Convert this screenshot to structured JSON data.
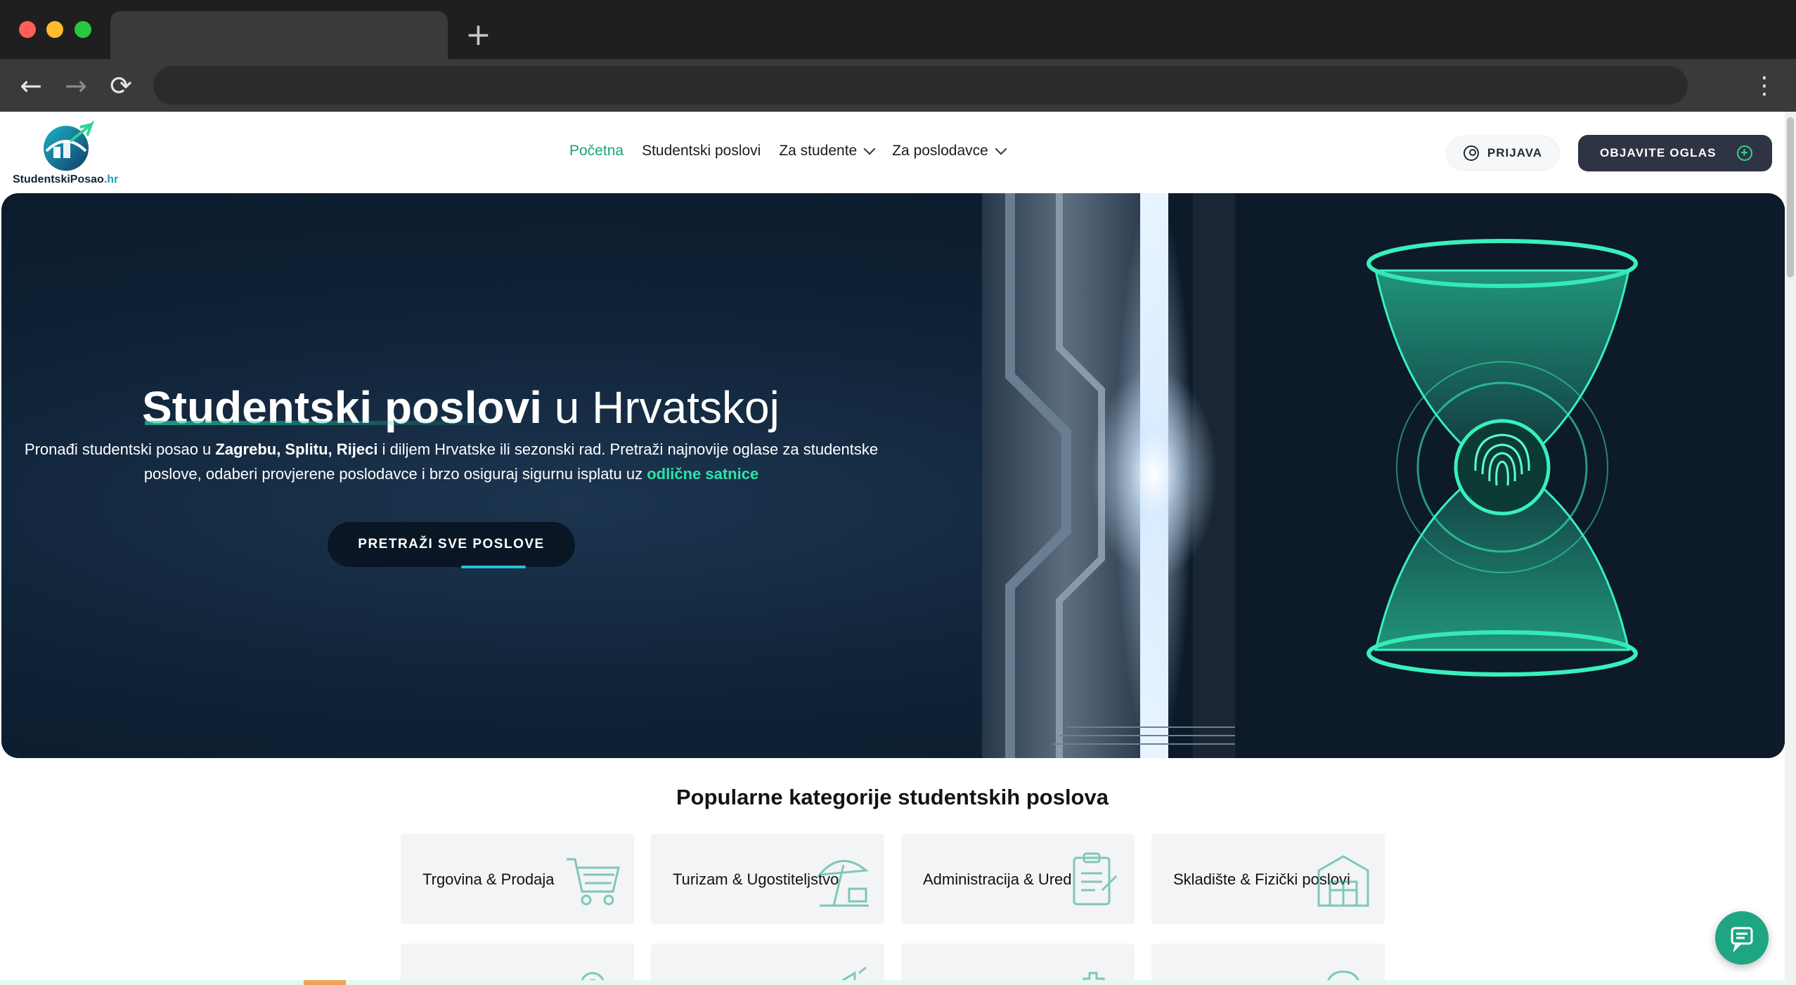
{
  "browser": {
    "new_tab_glyph": "+",
    "back_glyph": "←",
    "forward_glyph": "→",
    "reload_glyph": "⟳",
    "menu_glyph": "⋮"
  },
  "header": {
    "logo_text_main": "StudentskiPosao",
    "logo_text_tld": ".hr",
    "nav": [
      {
        "label": "Početna",
        "active": true
      },
      {
        "label": "Studentski poslovi"
      },
      {
        "label": "Za studente",
        "dropdown": true
      },
      {
        "label": "Za poslodavce",
        "dropdown": true
      }
    ],
    "login_label": "PRIJAVA",
    "post_ad_label": "OBJAVITE OGLAS"
  },
  "hero": {
    "title_bold": "Studentski poslovi",
    "title_rest": " u Hrvatskoj",
    "subtitle_p1": "Pronađi studentski posao u ",
    "subtitle_cities": "Zagrebu, Splitu, Rijeci",
    "subtitle_p2": " i diljem Hrvatske ili sezonski rad. Pretraži najnovije oglase za studentske poslove, odaberi provjerene poslodavce i brzo osiguraj sigurnu isplatu uz ",
    "subtitle_highlight": "odlične satnice",
    "cta_label": "PRETRAŽI SVE POSLOVE"
  },
  "categories": {
    "title": "Popularne kategorije studentskih poslova",
    "items": [
      {
        "label": "Trgovina & Prodaja",
        "icon": "shopping-cart-icon"
      },
      {
        "label": "Turizam & Ugostiteljstvo",
        "icon": "beach-umbrella-icon"
      },
      {
        "label": "Administracija & Ured",
        "icon": "clipboard-icon"
      },
      {
        "label": "Skladište & Fizički poslovi",
        "icon": "warehouse-box-icon"
      }
    ]
  },
  "colors": {
    "accent": "#17a673",
    "hero_bg": "#0f2236",
    "dark_button": "#2e3443",
    "highlight": "#2ee3a6"
  }
}
